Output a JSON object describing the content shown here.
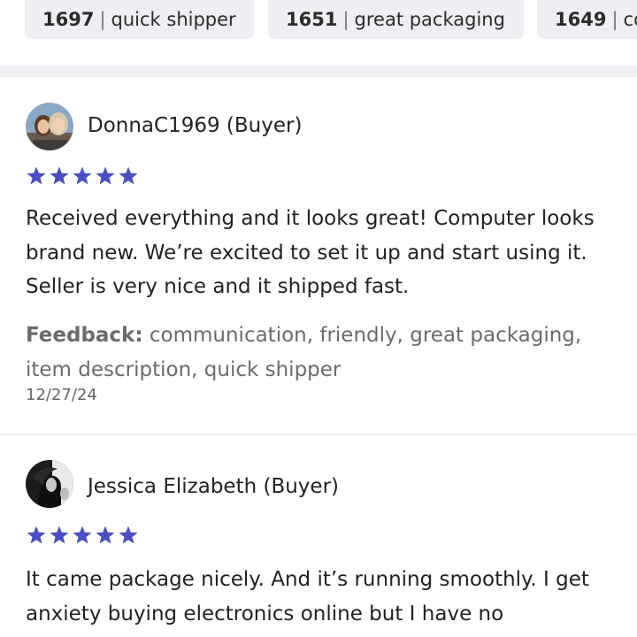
{
  "filter_chips": [
    {
      "count": "1697",
      "label": "quick shipper"
    },
    {
      "count": "1651",
      "label": "great packaging"
    },
    {
      "count": "1649",
      "label": "co"
    }
  ],
  "colors": {
    "star": "#4a4fc4",
    "chip_bg": "#eeeff2",
    "feedback_text": "#6b6b6b"
  },
  "reviews": [
    {
      "reviewer": "DonnaC1969 (Buyer)",
      "rating": 5,
      "avatar_icon": "user-photo-icon",
      "body": "Received everything and it looks great! Computer looks brand new. We’re excited to set it up and start using it. Seller is very nice and it shipped fast.",
      "feedback_label": "Feedback:",
      "feedback_tags": "communication, friendly, great packaging, item description, quick shipper",
      "date": "12/27/24"
    },
    {
      "reviewer": "Jessica Elizabeth (Buyer)",
      "rating": 5,
      "avatar_icon": "user-photo-icon",
      "body": "It came package nicely. And it’s running smoothly. I get anxiety buying electronics online but I have no"
    }
  ]
}
